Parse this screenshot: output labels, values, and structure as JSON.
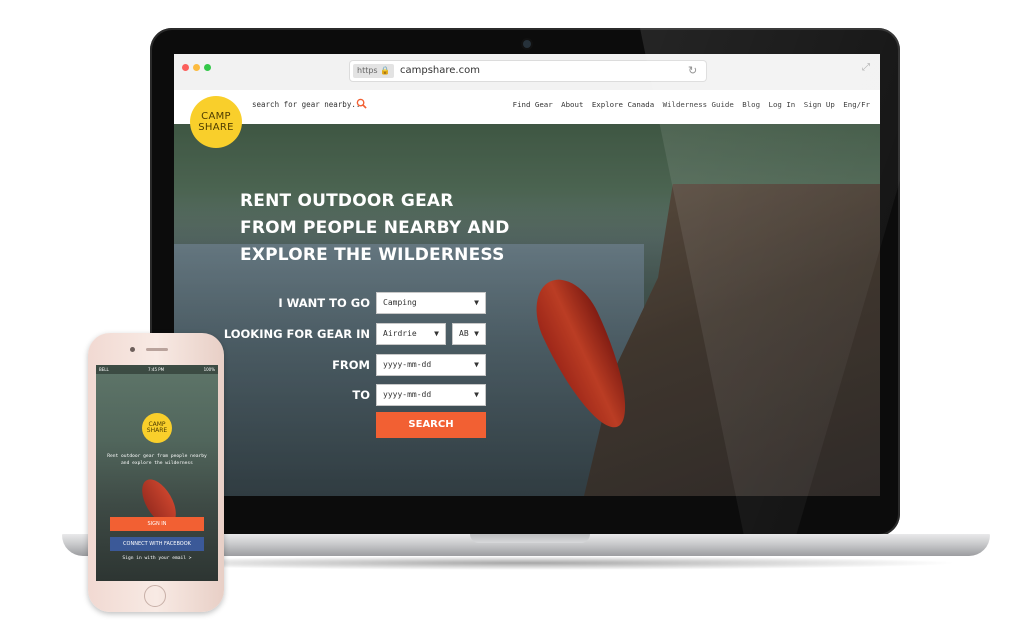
{
  "browser": {
    "protocol": "https",
    "url": "campshare.com"
  },
  "site": {
    "logo_line1": "CAMP",
    "logo_line2": "SHARE",
    "search_text": "search for gear nearby..",
    "nav": [
      "Find Gear",
      "About",
      "Explore Canada",
      "Wilderness Guide",
      "Blog",
      "Log In",
      "Sign Up",
      "Eng/Fr"
    ]
  },
  "hero": {
    "headline": [
      "RENT OUTDOOR GEAR",
      "FROM PEOPLE NEARBY AND",
      "EXPLORE THE WILDERNESS"
    ]
  },
  "form": {
    "want_label": "I WANT TO GO",
    "want_value": "Camping",
    "gear_label": "LOOKING FOR GEAR IN",
    "city_value": "Airdrie",
    "province_value": "AB",
    "from_label": "FROM",
    "from_placeholder": "yyyy-mm-dd",
    "to_label": "TO",
    "to_placeholder": "yyyy-mm-dd",
    "search_label": "SEARCH"
  },
  "phone": {
    "carrier": "BELL",
    "time": "7:45 PM",
    "battery": "100%",
    "logo_line1": "CAMP",
    "logo_line2": "SHARE",
    "tagline": "Rent outdoor gear from people nearby and explore the wilderness",
    "signin_label": "SIGN IN",
    "facebook_label": "CONNECT WITH FACEBOOK",
    "email_label": "Sign in with your email >"
  },
  "colors": {
    "accent": "#f26033",
    "logo": "#f9cf2b",
    "facebook": "#3b5998"
  }
}
